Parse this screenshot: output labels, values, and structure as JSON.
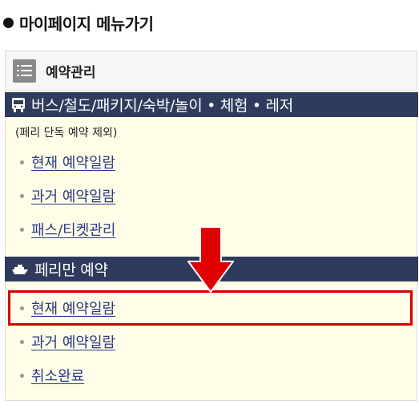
{
  "page_title": "마이페이지 메뉴가기",
  "panel": {
    "title": "예약관리",
    "sections": [
      {
        "heading": "버스/철도/패키지/숙박/놀이 • 체험 • 레저",
        "icon": "bus-icon",
        "note": "(페리 단독 예약 제외)",
        "links": [
          "현재 예약일람",
          "과거 예약일람",
          "패스/티켓관리"
        ]
      },
      {
        "heading": "페리만 예약",
        "icon": "ship-icon",
        "links": [
          "현재 예약일람",
          "과거 예약일람",
          "취소완료"
        ]
      }
    ]
  },
  "annotation": {
    "arrow_color": "#e00000",
    "highlight_color": "#d40000"
  },
  "colors": {
    "section_bar": "#2e3b5c",
    "panel_bg": "#fffde8",
    "link": "#2a3a84"
  }
}
